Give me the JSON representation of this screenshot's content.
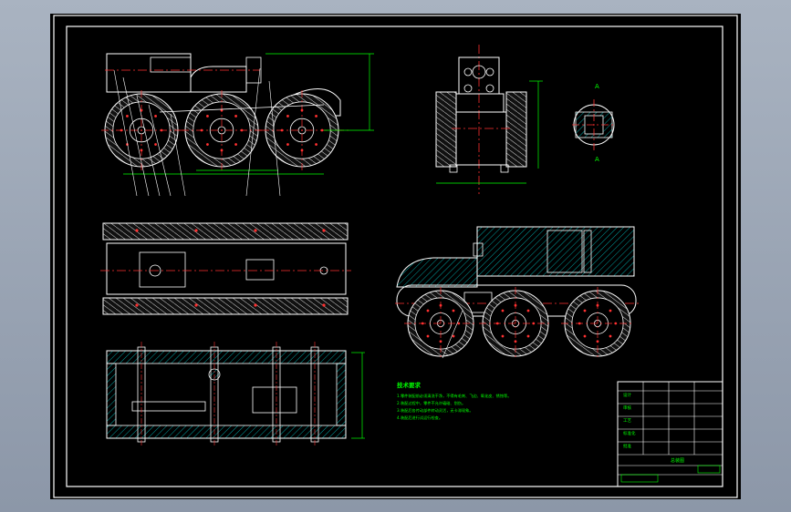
{
  "drawing": {
    "section_label_left": "A",
    "section_label_right": "A",
    "notes_heading": "技术要求",
    "notes": [
      "1.零件装配前必须清洗干净，不得有毛刺、飞边、氧化皮、锈蚀等。",
      "2.装配过程中，零件不允许磕碰、划伤。",
      "3.装配后各传动部件转动灵活，无卡滞现象。",
      "4.装配后进行试运行检查。"
    ],
    "title_block": {
      "drawing_name": "总装图",
      "rows": [
        "设计",
        "审核",
        "工艺",
        "标准化",
        "批准"
      ]
    }
  },
  "colors": {
    "background": "#000000",
    "outline": "#ffffff",
    "centerline": "#ff3030",
    "dimension": "#00ff00",
    "hatch": "#00c8c8",
    "notes": "#00ff00"
  }
}
